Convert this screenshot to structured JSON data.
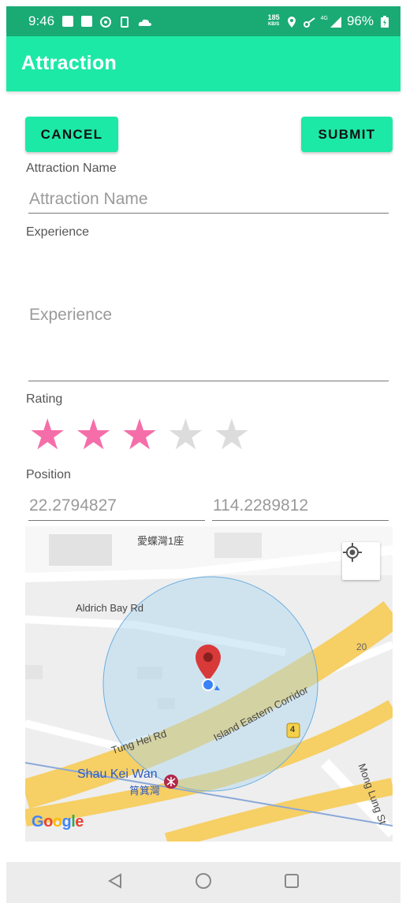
{
  "status_bar": {
    "time": "9:46",
    "speed_value": "185",
    "speed_unit": "KB/S",
    "network": "4G",
    "battery": "96%"
  },
  "app_bar": {
    "title": "Attraction"
  },
  "actions": {
    "cancel_label": "CANCEL",
    "submit_label": "SUBMIT"
  },
  "form": {
    "name_label": "Attraction Name",
    "name_placeholder": "Attraction Name",
    "experience_label": "Experience",
    "experience_placeholder": "Experience",
    "rating_label": "Rating",
    "rating_value": 3,
    "rating_max": 5,
    "position_label": "Position",
    "latitude": "22.2794827",
    "longitude": "114.2289812"
  },
  "map": {
    "building_label": "愛蝶灣1座",
    "road_aldrich": "Aldrich Bay Rd",
    "road_tung_hei": "Tung Hei Rd",
    "road_corridor": "Island Eastern Corridor",
    "road_mong_lung": "Mong Lung St",
    "station_name": "Shau Kei Wan",
    "station_name_zh": "筲箕灣",
    "route_shield_4": "4",
    "route_number_20": "20",
    "attribution": "Google",
    "accuracy_circle_color": "#a8d4f0",
    "marker_color": "#d83a3a",
    "road_color": "#f6cf65"
  },
  "icons": {
    "locate": "my-location-icon",
    "back": "back-triangle-icon",
    "home": "home-circle-icon",
    "recents": "recents-square-icon"
  },
  "colors": {
    "status_bar": "#1aab75",
    "accent": "#1de9a6",
    "star_on": "#f66ea9",
    "star_off": "#dcdcdc"
  }
}
